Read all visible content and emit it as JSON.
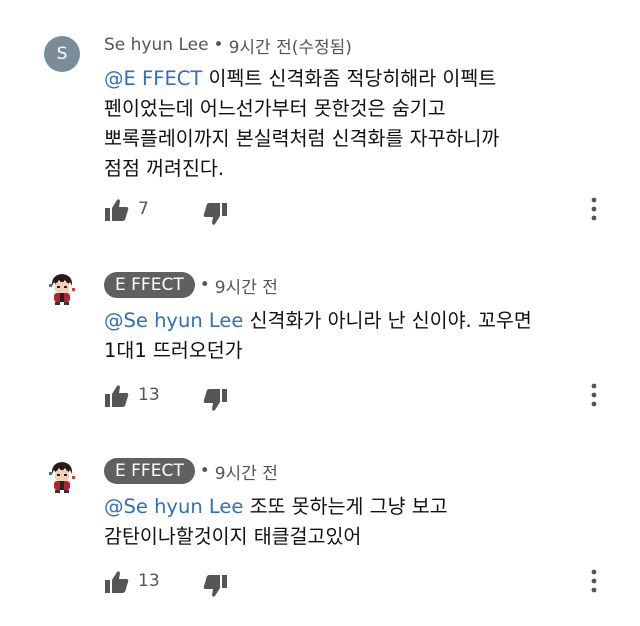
{
  "comments": [
    {
      "avatar_letter": "S",
      "author": "Se hyun Lee",
      "separator": "•",
      "time": "9시간 전(수정됨)",
      "mention": "@E FFECT",
      "text": " 이펙트 신격화좀 적당히해라 이펙트\n펜이었는데 어느선가부터 못한것은 숨기고\n뽀록플레이까지 본실력처럼 신격화를 자꾸하니까\n점점 꺼려진다.",
      "likes": "7"
    },
    {
      "author": "E FFECT",
      "separator": "•",
      "time": "9시간 전",
      "mention": "@Se hyun Lee",
      "text": " 신격화가 아니라 난 신이야. 꼬우면\n1대1 뜨러오던가",
      "likes": "13"
    },
    {
      "author": "E FFECT",
      "separator": "•",
      "time": "9시간 전",
      "mention": "@Se hyun Lee",
      "text": " 조또 못하는게 그냥 보고\n감탄이나할것이지 태클걸고있어",
      "likes": "13"
    }
  ],
  "icons": {
    "like": "thumbs-up-icon",
    "dislike": "thumbs-down-icon",
    "more": "more-vertical-icon"
  },
  "colors": {
    "mention": "#2f6fbf",
    "badge_bg": "#606060",
    "avatar_bg": "#7a8c98",
    "icon": "#555555"
  }
}
